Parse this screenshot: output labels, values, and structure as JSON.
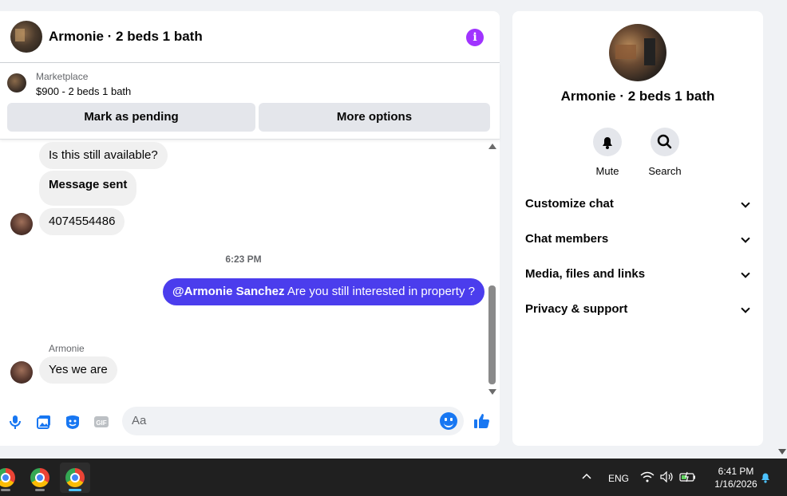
{
  "chat": {
    "title": "Armonie · 2 beds 1 bath",
    "info_icon": "i",
    "marketplace": {
      "label": "Marketplace",
      "price": "$900 - 2 beds 1 bath",
      "pending_label": "Mark as pending",
      "options_label": "More options"
    },
    "messages": [
      {
        "text": "Is this still available?"
      },
      {
        "text": "Message sent"
      },
      {
        "text": "4074554486"
      }
    ],
    "timestamp": "6:23 PM",
    "sent_message": {
      "mention": "@Armonie Sanchez",
      "text": " Are you still interested in property ?"
    },
    "reply_sender": "Armonie",
    "reply_text": "Yes we are",
    "input_placeholder": "Aa"
  },
  "side": {
    "name": "Armonie · 2 beds 1 bath",
    "actions": [
      {
        "label": "Mute",
        "icon": "bell-icon"
      },
      {
        "label": "Search",
        "icon": "search-icon"
      }
    ],
    "sections": [
      "Customize chat",
      "Chat members",
      "Media, files and links",
      "Privacy & support"
    ]
  },
  "taskbar": {
    "language": "ENG",
    "time": "6:41 PM",
    "date": "1/16/2026"
  },
  "colors": {
    "accent": "#4b3ded",
    "link": "#1877f2",
    "info": "#a033ff"
  }
}
